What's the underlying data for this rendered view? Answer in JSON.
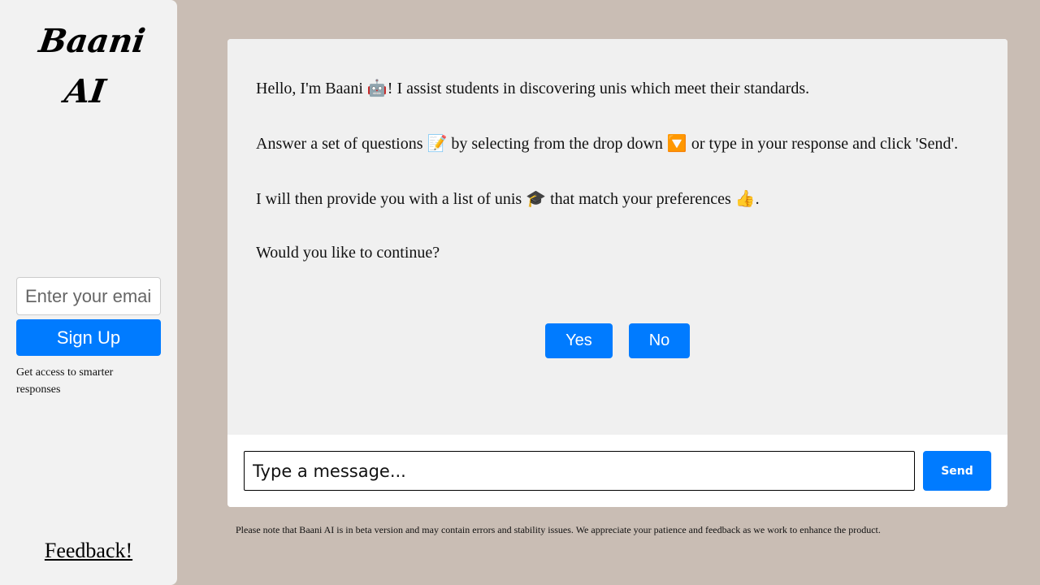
{
  "sidebar": {
    "logo_line1": "Baani",
    "logo_line2": "AI",
    "email_placeholder": "Enter your email",
    "signup_label": "Sign Up",
    "signup_note": "Get access to smarter responses",
    "feedback_label": "Feedback!"
  },
  "chat": {
    "messages": [
      "Hello, I'm Baani 🤖! I assist students in discovering unis which meet their standards.",
      "Answer a set of questions 📝 by selecting from the drop down 🔽 or type in your response and click 'Send'.",
      "I will then provide you with a list of unis 🎓 that match your preferences 👍.",
      "Would you like to continue?"
    ],
    "choices": {
      "yes": "Yes",
      "no": "No"
    },
    "input_placeholder": "Type a message...",
    "send_label": "Send"
  },
  "disclaimer": "Please note that Baani AI is in beta version and may contain errors and stability issues. We appreciate your patience and feedback as we work to enhance the product.",
  "colors": {
    "accent": "#007bff",
    "page_background": "#c9bdb4",
    "panel_background": "#f2f2f2"
  }
}
